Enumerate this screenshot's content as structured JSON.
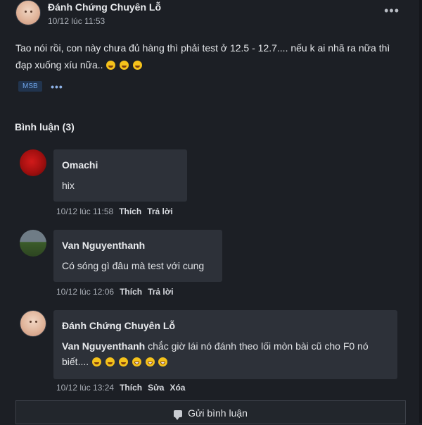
{
  "post": {
    "author": "Đánh Chứng Chuyên Lỗ",
    "time": "10/12 lúc 11:53",
    "text": "Tao nói rồi, con này chưa đủ hàng thì phải test ở 12.5 - 12.7.... nếu k ai nhã ra nữa thì đạp xuống xíu nữa..",
    "emoji_count": 3,
    "more_icon": "•••",
    "tag": "MSB",
    "tag_more": "•••"
  },
  "comments_section": {
    "title": "Bình luận (3)"
  },
  "comments": [
    {
      "name": "Omachi",
      "text": "hix",
      "time": "10/12 lúc 11:58",
      "action1": "Thích",
      "action2": "Trả lời"
    },
    {
      "name": "Van Nguyenthanh",
      "text": "Có sóng gì đâu mà test với cung",
      "time": "10/12 lúc 12:06",
      "action1": "Thích",
      "action2": "Trả lời"
    },
    {
      "name": "Đánh Chứng Chuyên Lỗ",
      "mention": "Van Nguyenthanh",
      "text": "chắc giờ lái nó đánh theo lối mòn bài cũ cho F0 nó biết....",
      "time": "10/12 lúc 13:24",
      "action1": "Thích",
      "action2": "Sửa",
      "action3": "Xóa"
    }
  ],
  "composer": {
    "button_label": "Gửi bình luận",
    "icon": "chat-bubble-icon"
  }
}
